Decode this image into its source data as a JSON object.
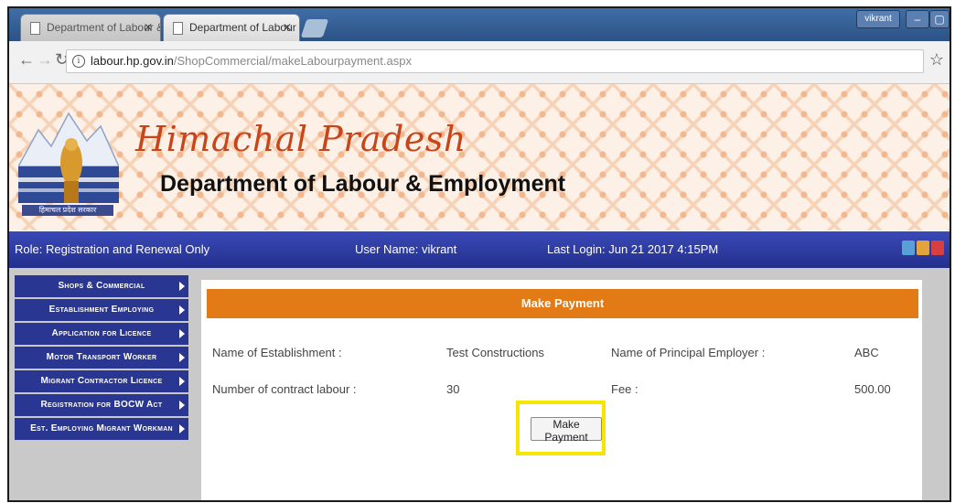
{
  "browser": {
    "tabs": [
      {
        "title": "Department of Labour &",
        "active": false
      },
      {
        "title": "Department of Labour &",
        "active": true
      }
    ],
    "close_glyph": "✕",
    "window_user": "vikrant",
    "url_host": "labour.hp.gov.in",
    "url_path": "/ShopCommercial/makeLabourpayment.aspx",
    "info_glyph": "i",
    "star_glyph": "☆"
  },
  "banner": {
    "title": "Himachal Pradesh",
    "subtitle": "Department of Labour & Employment",
    "logo_caption": "हिमाचल प्रदेश सरकार"
  },
  "infobar": {
    "role": "Role: Registration and Renewal Only",
    "user": "User Name: vikrant",
    "last_login": "Last Login: Jun 21 2017 4:15PM"
  },
  "sidebar": {
    "items": [
      {
        "label": "Shops & Commercial"
      },
      {
        "label": "Establishment Employing"
      },
      {
        "label": "Application for Licence"
      },
      {
        "label": "Motor Transport Worker"
      },
      {
        "label": "Migrant Contractor Licence"
      },
      {
        "label": "Registration for BOCW Act"
      },
      {
        "label": "Est. Employing Migrant Workman"
      }
    ]
  },
  "main": {
    "header": "Make Payment",
    "establishment_label": "Name of Establishment :",
    "establishment_value": "Test Constructions",
    "principal_label": "Name of Principal Employer :",
    "principal_value": "ABC",
    "labour_label": "Number of contract labour :",
    "labour_value": "30",
    "fee_label": "Fee :",
    "fee_value": "500.00",
    "pay_button": "Make Payment"
  },
  "colors": {
    "nav_blue": "#2a3792",
    "header_orange": "#e27b15",
    "highlight_yellow": "#f5e600",
    "brand_red": "#c8451a"
  }
}
